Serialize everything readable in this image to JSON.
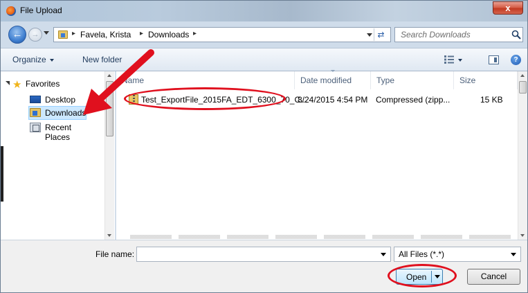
{
  "window": {
    "title": "File Upload",
    "close_label": "x"
  },
  "address": {
    "crumbs": [
      "Favela, Krista",
      "Downloads"
    ],
    "search_placeholder": "Search Downloads"
  },
  "toolbar": {
    "organize": "Organize",
    "new_folder": "New folder"
  },
  "nav": {
    "favorites": "Favorites",
    "items": [
      {
        "label": "Desktop"
      },
      {
        "label": "Downloads"
      },
      {
        "label": "Recent Places"
      }
    ]
  },
  "columns": [
    "Name",
    "Date modified",
    "Type",
    "Size"
  ],
  "files": [
    {
      "name": "Test_ExportFile_2015FA_EDT_6300_70_C...",
      "date": "8/24/2015 4:54 PM",
      "type": "Compressed (zipp...",
      "size": "15 KB"
    }
  ],
  "bottom": {
    "file_name_label": "File name:",
    "file_name_value": "",
    "filter": "All Files (*.*)",
    "open": "Open",
    "cancel": "Cancel"
  },
  "annotation_color": "#e0101e"
}
